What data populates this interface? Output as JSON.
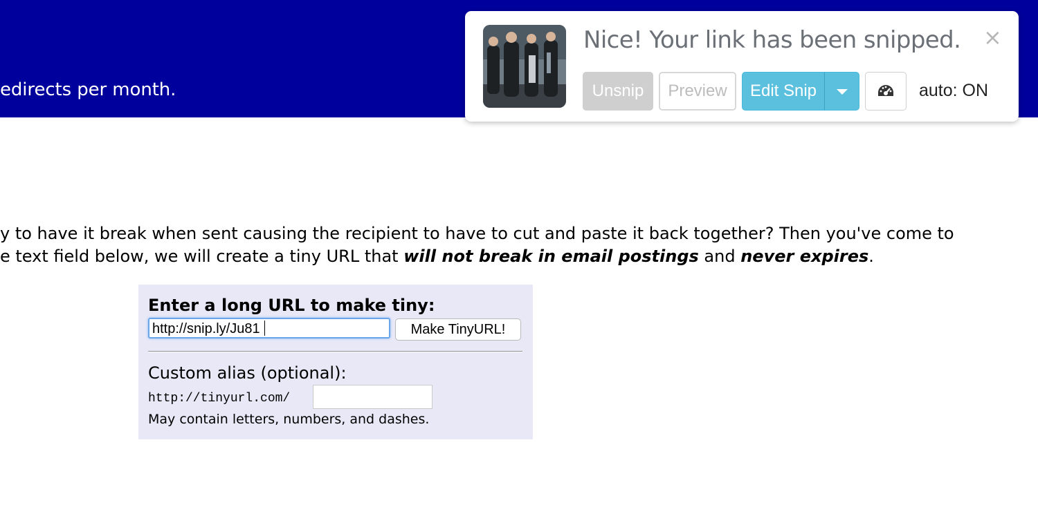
{
  "banner": {
    "text": "edirects per month.",
    "background_color": "#00009c"
  },
  "intro": {
    "line1": "y to have it break when sent causing the recipient to have to cut and paste it back together? Then you've come to",
    "line2_start": "e text field below, we will create a tiny URL that ",
    "line2_emph1": "will not break in email postings",
    "line2_mid": " and ",
    "line2_emph2": "never expires",
    "line2_end": "."
  },
  "form": {
    "heading": "Enter a long URL to make tiny:",
    "url_value": "http://snip.ly/Ju81",
    "submit_label": "Make TinyURL!",
    "alias_label": "Custom alias (optional):",
    "alias_prefix": "http://tinyurl.com/",
    "alias_value": "",
    "alias_hint": "May contain letters, numbers, and dashes.",
    "background_color": "#e8e8f7"
  },
  "snip_popup": {
    "message": "Nice! Your link has been snipped.",
    "close_icon": "close-icon",
    "buttons": {
      "unsnip": "Unsnip",
      "preview": "Preview",
      "edit": "Edit Snip",
      "dropdown_icon": "caret-down-icon",
      "stats_icon": "gauge-icon"
    },
    "auto_status": "auto: ON",
    "accent_color": "#5bc0de"
  }
}
